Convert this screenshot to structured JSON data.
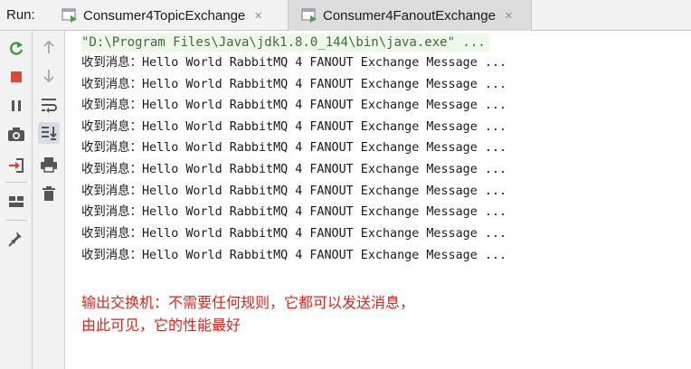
{
  "run_label": "Run:",
  "tabs": [
    {
      "label": "Consumer4TopicExchange",
      "close": "×",
      "active": false
    },
    {
      "label": "Consumer4FanoutExchange",
      "close": "×",
      "active": true
    }
  ],
  "toolbar_left": [
    "rerun-icon",
    "stop-icon",
    "pause-icon",
    "camera-icon",
    "login-icon",
    "layout-icon",
    "pin-icon"
  ],
  "toolbar_right": [
    "up-arrow-icon",
    "down-arrow-icon",
    "soft-wrap-icon",
    "scroll-to-end-icon",
    "print-icon",
    "trash-icon"
  ],
  "console": {
    "command": "\"D:\\Program Files\\Java\\jdk1.8.0_144\\bin\\java.exe\" ...",
    "lines": [
      "收到消息：Hello World RabbitMQ 4 FANOUT Exchange Message ...",
      "收到消息：Hello World RabbitMQ 4 FANOUT Exchange Message ...",
      "收到消息：Hello World RabbitMQ 4 FANOUT Exchange Message ...",
      "收到消息：Hello World RabbitMQ 4 FANOUT Exchange Message ...",
      "收到消息：Hello World RabbitMQ 4 FANOUT Exchange Message ...",
      "收到消息：Hello World RabbitMQ 4 FANOUT Exchange Message ...",
      "收到消息：Hello World RabbitMQ 4 FANOUT Exchange Message ...",
      "收到消息：Hello World RabbitMQ 4 FANOUT Exchange Message ...",
      "收到消息：Hello World RabbitMQ 4 FANOUT Exchange Message ...",
      "收到消息：Hello World RabbitMQ 4 FANOUT Exchange Message ..."
    ]
  },
  "annotation": {
    "line1": "输出交换机：不需要任何规则，它都可以发送消息，",
    "line2": "由此可见，它的性能最好"
  },
  "colors": {
    "annotation": "#e0241b",
    "command": "#3b6e3b",
    "rerun": "#3d9c3d",
    "stop": "#e0463a"
  }
}
